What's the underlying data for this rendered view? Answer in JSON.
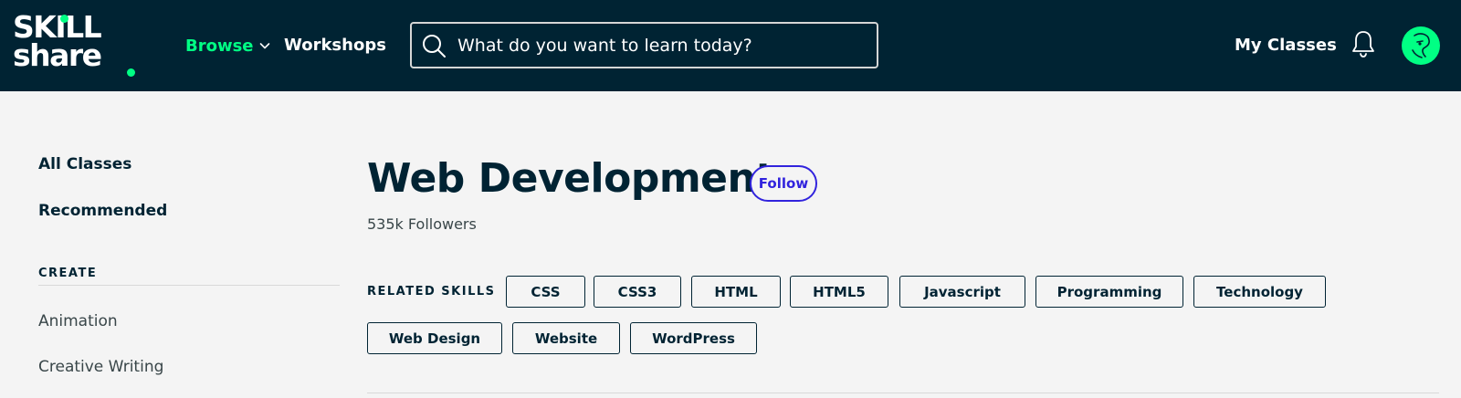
{
  "header": {
    "logo_line1": "SKILL",
    "logo_line2": "share",
    "browse_label": "Browse",
    "workshops_label": "Workshops",
    "search_placeholder": "What do you want to learn today?",
    "my_classes_label": "My Classes",
    "icons": [
      "chevron-down-icon",
      "search-icon",
      "bell-icon",
      "avatar"
    ]
  },
  "sidebar": {
    "all_classes": "All Classes",
    "recommended": "Recommended",
    "section_title": "CREATE",
    "categories": [
      "Animation",
      "Creative Writing"
    ]
  },
  "main": {
    "title": "Web Development",
    "follow_label": "Follow",
    "followers": "535k Followers",
    "related_label": "RELATED SKILLS",
    "skills": [
      "CSS",
      "CSS3",
      "HTML",
      "HTML5",
      "Javascript",
      "Programming",
      "Technology",
      "Web Design",
      "Website",
      "WordPress"
    ]
  },
  "colors": {
    "header_bg": "#002333",
    "accent_green": "#00ff84",
    "follow_blue": "#3123dd",
    "page_bg": "#f4f4f4"
  }
}
